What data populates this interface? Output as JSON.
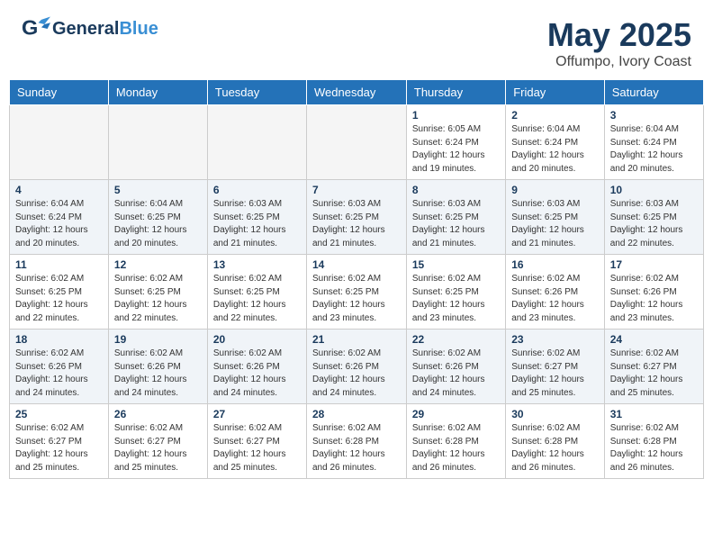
{
  "app": {
    "logo_general": "General",
    "logo_blue": "Blue",
    "title": "May 2025",
    "subtitle": "Offumpo, Ivory Coast"
  },
  "calendar": {
    "days_of_week": [
      "Sunday",
      "Monday",
      "Tuesday",
      "Wednesday",
      "Thursday",
      "Friday",
      "Saturday"
    ],
    "weeks": [
      [
        {
          "day": "",
          "info": ""
        },
        {
          "day": "",
          "info": ""
        },
        {
          "day": "",
          "info": ""
        },
        {
          "day": "",
          "info": ""
        },
        {
          "day": "1",
          "info": "Sunrise: 6:05 AM\nSunset: 6:24 PM\nDaylight: 12 hours\nand 19 minutes."
        },
        {
          "day": "2",
          "info": "Sunrise: 6:04 AM\nSunset: 6:24 PM\nDaylight: 12 hours\nand 20 minutes."
        },
        {
          "day": "3",
          "info": "Sunrise: 6:04 AM\nSunset: 6:24 PM\nDaylight: 12 hours\nand 20 minutes."
        }
      ],
      [
        {
          "day": "4",
          "info": "Sunrise: 6:04 AM\nSunset: 6:24 PM\nDaylight: 12 hours\nand 20 minutes."
        },
        {
          "day": "5",
          "info": "Sunrise: 6:04 AM\nSunset: 6:25 PM\nDaylight: 12 hours\nand 20 minutes."
        },
        {
          "day": "6",
          "info": "Sunrise: 6:03 AM\nSunset: 6:25 PM\nDaylight: 12 hours\nand 21 minutes."
        },
        {
          "day": "7",
          "info": "Sunrise: 6:03 AM\nSunset: 6:25 PM\nDaylight: 12 hours\nand 21 minutes."
        },
        {
          "day": "8",
          "info": "Sunrise: 6:03 AM\nSunset: 6:25 PM\nDaylight: 12 hours\nand 21 minutes."
        },
        {
          "day": "9",
          "info": "Sunrise: 6:03 AM\nSunset: 6:25 PM\nDaylight: 12 hours\nand 21 minutes."
        },
        {
          "day": "10",
          "info": "Sunrise: 6:03 AM\nSunset: 6:25 PM\nDaylight: 12 hours\nand 22 minutes."
        }
      ],
      [
        {
          "day": "11",
          "info": "Sunrise: 6:02 AM\nSunset: 6:25 PM\nDaylight: 12 hours\nand 22 minutes."
        },
        {
          "day": "12",
          "info": "Sunrise: 6:02 AM\nSunset: 6:25 PM\nDaylight: 12 hours\nand 22 minutes."
        },
        {
          "day": "13",
          "info": "Sunrise: 6:02 AM\nSunset: 6:25 PM\nDaylight: 12 hours\nand 22 minutes."
        },
        {
          "day": "14",
          "info": "Sunrise: 6:02 AM\nSunset: 6:25 PM\nDaylight: 12 hours\nand 23 minutes."
        },
        {
          "day": "15",
          "info": "Sunrise: 6:02 AM\nSunset: 6:25 PM\nDaylight: 12 hours\nand 23 minutes."
        },
        {
          "day": "16",
          "info": "Sunrise: 6:02 AM\nSunset: 6:26 PM\nDaylight: 12 hours\nand 23 minutes."
        },
        {
          "day": "17",
          "info": "Sunrise: 6:02 AM\nSunset: 6:26 PM\nDaylight: 12 hours\nand 23 minutes."
        }
      ],
      [
        {
          "day": "18",
          "info": "Sunrise: 6:02 AM\nSunset: 6:26 PM\nDaylight: 12 hours\nand 24 minutes."
        },
        {
          "day": "19",
          "info": "Sunrise: 6:02 AM\nSunset: 6:26 PM\nDaylight: 12 hours\nand 24 minutes."
        },
        {
          "day": "20",
          "info": "Sunrise: 6:02 AM\nSunset: 6:26 PM\nDaylight: 12 hours\nand 24 minutes."
        },
        {
          "day": "21",
          "info": "Sunrise: 6:02 AM\nSunset: 6:26 PM\nDaylight: 12 hours\nand 24 minutes."
        },
        {
          "day": "22",
          "info": "Sunrise: 6:02 AM\nSunset: 6:26 PM\nDaylight: 12 hours\nand 24 minutes."
        },
        {
          "day": "23",
          "info": "Sunrise: 6:02 AM\nSunset: 6:27 PM\nDaylight: 12 hours\nand 25 minutes."
        },
        {
          "day": "24",
          "info": "Sunrise: 6:02 AM\nSunset: 6:27 PM\nDaylight: 12 hours\nand 25 minutes."
        }
      ],
      [
        {
          "day": "25",
          "info": "Sunrise: 6:02 AM\nSunset: 6:27 PM\nDaylight: 12 hours\nand 25 minutes."
        },
        {
          "day": "26",
          "info": "Sunrise: 6:02 AM\nSunset: 6:27 PM\nDaylight: 12 hours\nand 25 minutes."
        },
        {
          "day": "27",
          "info": "Sunrise: 6:02 AM\nSunset: 6:27 PM\nDaylight: 12 hours\nand 25 minutes."
        },
        {
          "day": "28",
          "info": "Sunrise: 6:02 AM\nSunset: 6:28 PM\nDaylight: 12 hours\nand 26 minutes."
        },
        {
          "day": "29",
          "info": "Sunrise: 6:02 AM\nSunset: 6:28 PM\nDaylight: 12 hours\nand 26 minutes."
        },
        {
          "day": "30",
          "info": "Sunrise: 6:02 AM\nSunset: 6:28 PM\nDaylight: 12 hours\nand 26 minutes."
        },
        {
          "day": "31",
          "info": "Sunrise: 6:02 AM\nSunset: 6:28 PM\nDaylight: 12 hours\nand 26 minutes."
        }
      ]
    ]
  }
}
